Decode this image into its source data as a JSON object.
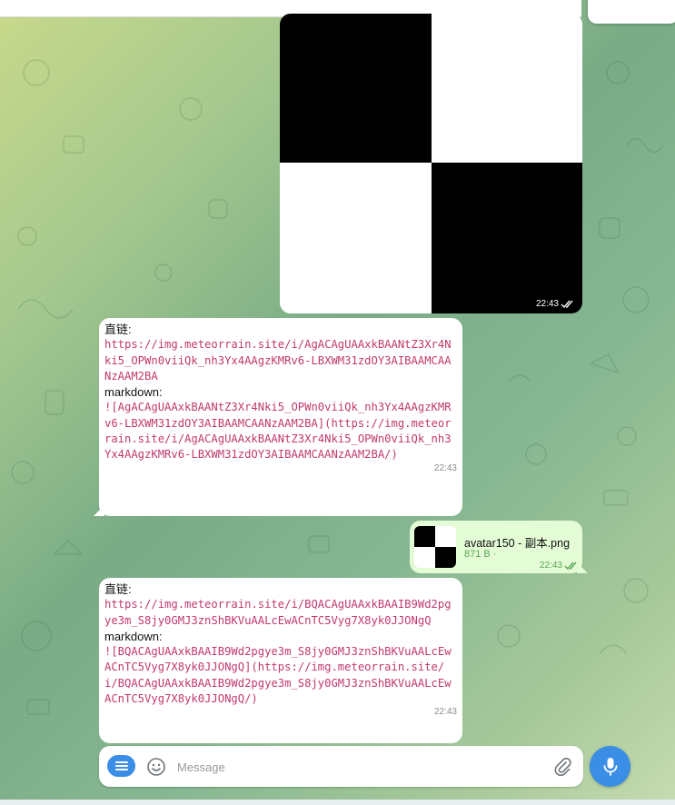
{
  "messages": {
    "image_message": {
      "time": "22:43"
    },
    "link_message_1": {
      "label_direct": "直链:",
      "direct_url": "https://img.meteorrain.site/i/AgACAgUAAxkBAANtZ3Xr4Nki5_OPWn0viiQk_nh3Yx4AAgzKMRv6-LBXWM31zdOY3AIBAAMCAANzAAM2BA",
      "label_markdown": "markdown:",
      "markdown_text": "![AgACAgUAAxkBAANtZ3Xr4Nki5_OPWn0viiQk_nh3Yx4AAgzKMRv6-LBXWM31zdOY3AIBAAMCAANzAAM2BA](https://img.meteorrain.site/i/AgACAgUAAxkBAANtZ3Xr4Nki5_OPWn0viiQk_nh3Yx4AAgzKMRv6-LBXWM31zdOY3AIBAAMCAANzAAM2BA/)",
      "time": "22:43"
    },
    "file_message": {
      "file_name": "avatar150 - 副本.png",
      "file_size": "871 B ·",
      "time": "22:43"
    },
    "link_message_2": {
      "label_direct": "直链:",
      "direct_url": "https://img.meteorrain.site/i/BQACAgUAAxkBAAIB9Wd2pgye3m_S8jy0GMJ3znShBKVuAALcEwACnTC5Vyg7X8yk0JJONgQ",
      "label_markdown": "markdown:",
      "markdown_text": "![BQACAgUAAxkBAAIB9Wd2pgye3m_S8jy0GMJ3znShBKVuAALcEwACnTC5Vyg7X8yk0JJONgQ](https://img.meteorrain.site/i/BQACAgUAAxkBAAIB9Wd2pgye3m_S8jy0GMJ3znShBKVuAALcEwACnTC5Vyg7X8yk0JJONgQ/)",
      "time": "22:43"
    }
  },
  "composer": {
    "placeholder": "Message",
    "menu_icon": "menu-icon",
    "emoji_icon": "smile-icon",
    "attach_icon": "paperclip-icon",
    "mic_icon": "microphone-icon"
  },
  "colors": {
    "accent": "#3a8ee6",
    "outgoing_bubble": "#e3fcd6",
    "link_text": "#c2396e",
    "read_check": "#5aa453"
  }
}
